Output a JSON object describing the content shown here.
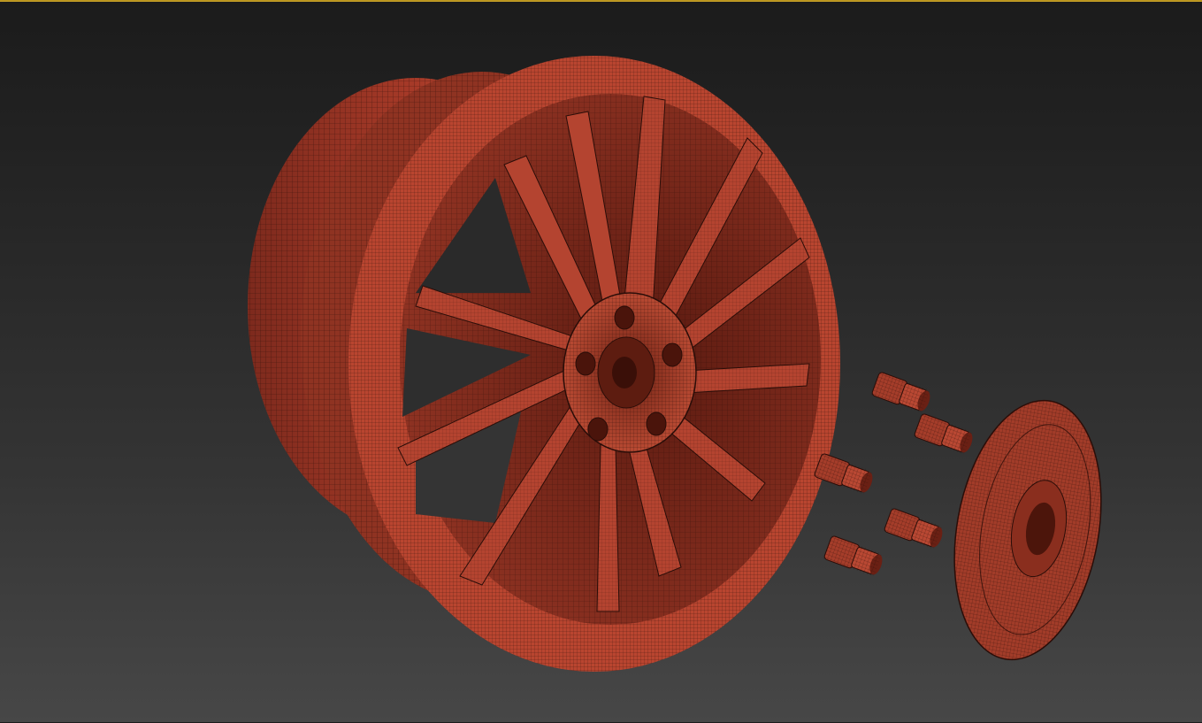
{
  "viewport": {
    "active_border_color": "#c9a227",
    "background_top": "#1b1b1b",
    "background_bottom": "#474747"
  },
  "scene": {
    "objects": [
      {
        "name": "wheel-rim",
        "spoke_count": 12,
        "lug_hole_count": 5
      },
      {
        "name": "lug-nut",
        "count": 5
      },
      {
        "name": "center-cap",
        "count": 1
      }
    ],
    "material_color": "#b8432f",
    "wire_color": "#2a0d08",
    "display_mode": "wireframe-on-shaded"
  }
}
